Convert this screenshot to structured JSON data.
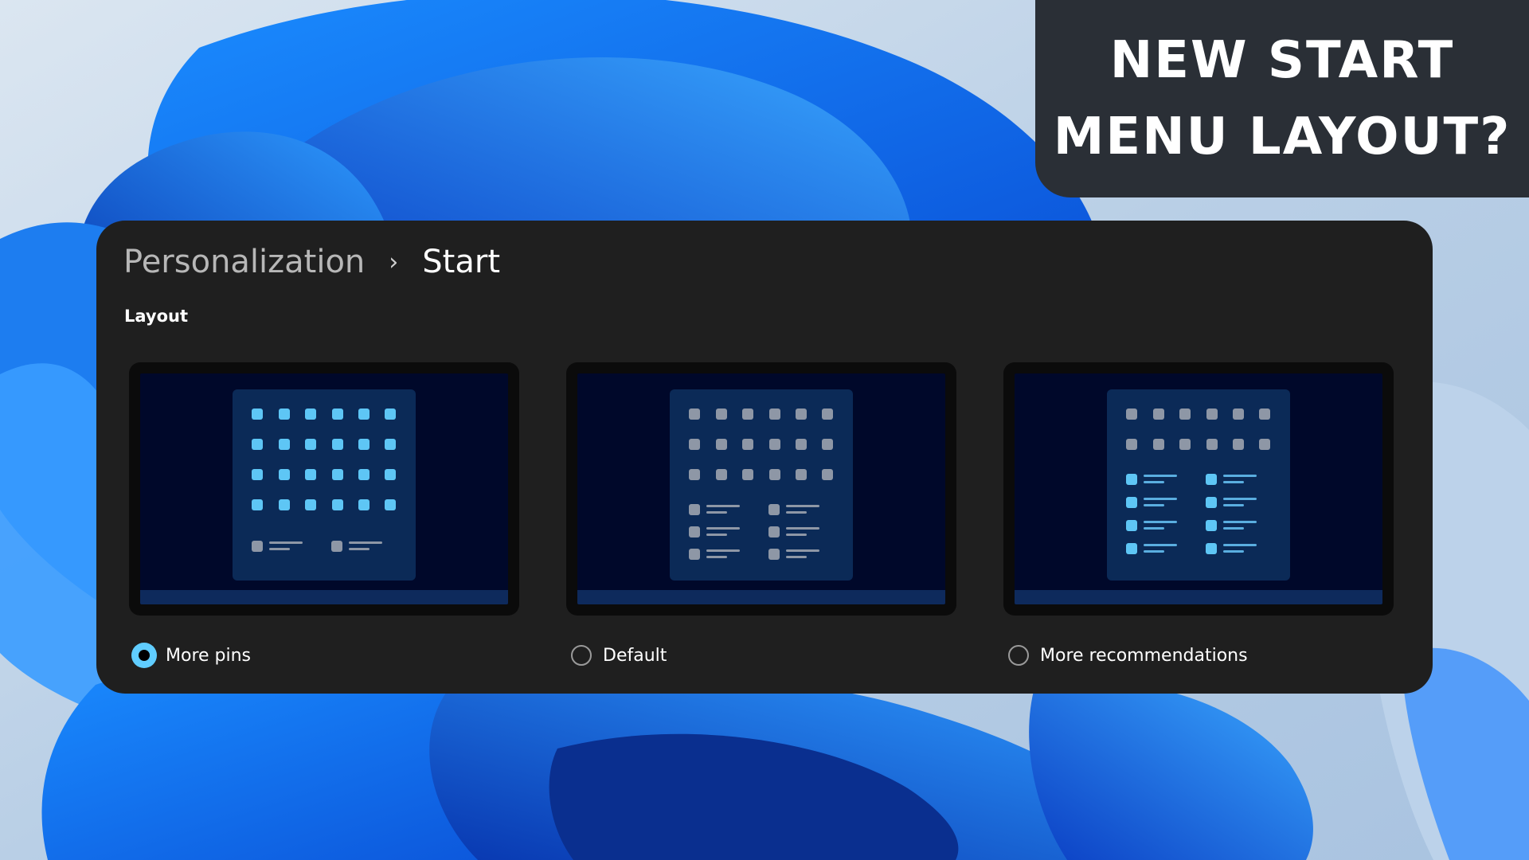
{
  "banner": {
    "line1": "NEW START",
    "line2": "MENU LAYOUT?"
  },
  "breadcrumb": {
    "parent": "Personalization",
    "separator": "›",
    "current": "Start"
  },
  "section": {
    "label": "Layout"
  },
  "options": [
    {
      "id": "more-pins",
      "label": "More pins",
      "selected": true
    },
    {
      "id": "default",
      "label": "Default",
      "selected": false
    },
    {
      "id": "more-recommendations",
      "label": "More recommendations",
      "selected": false
    }
  ],
  "colors": {
    "accent": "#60cdff",
    "panel": "#1f1f1f",
    "banner": "#2a2f36",
    "wallpaper_blue": "#1f6fe8"
  }
}
